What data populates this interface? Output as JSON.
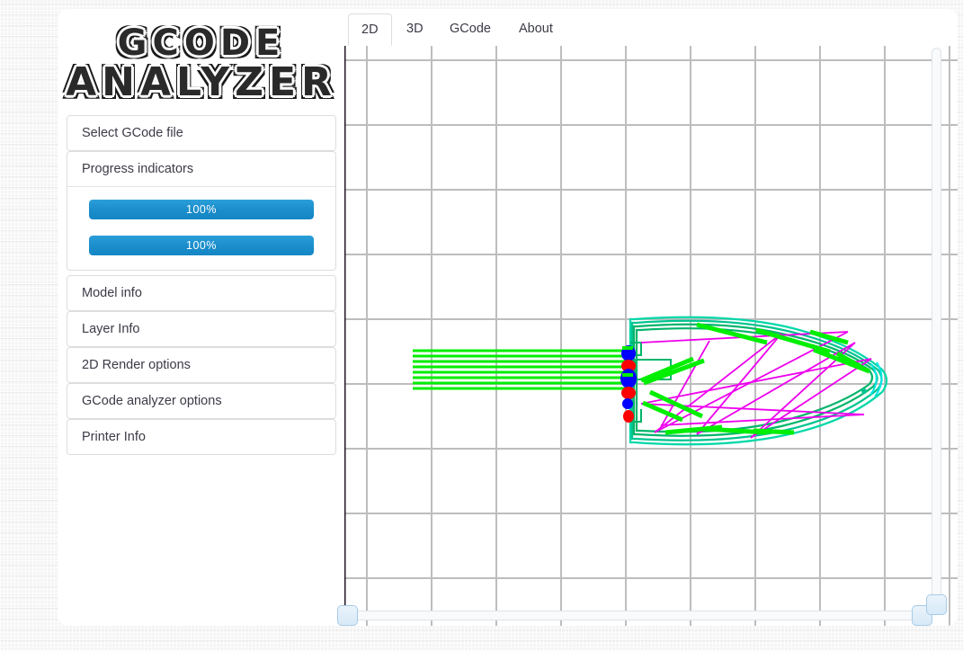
{
  "app": {
    "logo_line1": "GCODE",
    "logo_line2": "ANALYZER",
    "accent_color": "#1b8ecb",
    "panel_border_color": "#dddddd",
    "text_color": "#3b3b47"
  },
  "sidebar": {
    "panels": [
      {
        "label": "Select GCode file",
        "expanded": false
      },
      {
        "label": "Progress indicators",
        "expanded": true
      },
      {
        "label": "Model info",
        "expanded": false
      },
      {
        "label": "Layer Info",
        "expanded": false
      },
      {
        "label": "2D Render options",
        "expanded": false
      },
      {
        "label": "GCode analyzer options",
        "expanded": false
      },
      {
        "label": "Printer Info",
        "expanded": false
      }
    ],
    "progress": {
      "bar1_label": "100%",
      "bar1_value": 100,
      "bar2_label": "100%",
      "bar2_value": 100
    }
  },
  "tabs": [
    {
      "label": "2D",
      "active": true
    },
    {
      "label": "3D",
      "active": false
    },
    {
      "label": "GCode",
      "active": false
    },
    {
      "label": "About",
      "active": false
    }
  ],
  "canvas": {
    "grid_color": "#bdbdbd",
    "grid_spacing_px": 72,
    "axis_color": "#231723",
    "colors": {
      "perimeter": "#00b56a",
      "outer_perimeter": "#00e5c0",
      "infill": "#00ee00",
      "travel": "#ee00ee",
      "retract": "#ff0000",
      "restart": "#0000ff"
    }
  },
  "sliders": {
    "horizontal": {
      "name": "layer-range-slider",
      "low": 0,
      "high": 100
    },
    "vertical": {
      "name": "layer-slider",
      "value": 0
    }
  }
}
